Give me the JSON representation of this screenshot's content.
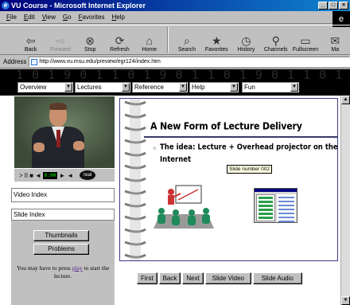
{
  "window": {
    "title": "VU Course - Microsoft Internet Explorer",
    "min_btn": "_",
    "max_btn": "□",
    "close_btn": "×"
  },
  "menu": [
    "File",
    "Edit",
    "View",
    "Go",
    "Favorites",
    "Help"
  ],
  "toolbar": [
    {
      "label": "Back",
      "icon": "back-arrow-icon",
      "glyph": "⇦",
      "enabled": true
    },
    {
      "label": "Forward",
      "icon": "forward-arrow-icon",
      "glyph": "⇨",
      "enabled": false
    },
    {
      "label": "Stop",
      "icon": "stop-icon",
      "glyph": "⊗",
      "enabled": true
    },
    {
      "label": "Refresh",
      "icon": "refresh-icon",
      "glyph": "⟳",
      "enabled": true
    },
    {
      "label": "Home",
      "icon": "home-icon",
      "glyph": "⌂",
      "enabled": true
    },
    {
      "label": "Search",
      "icon": "search-icon",
      "glyph": "⌕",
      "enabled": true
    },
    {
      "label": "Favorites",
      "icon": "favorites-icon",
      "glyph": "★",
      "enabled": true
    },
    {
      "label": "History",
      "icon": "history-icon",
      "glyph": "◷",
      "enabled": true
    },
    {
      "label": "Channels",
      "icon": "channels-icon",
      "glyph": "⚲",
      "enabled": true
    },
    {
      "label": "Fullscreen",
      "icon": "fullscreen-icon",
      "glyph": "▭",
      "enabled": true
    },
    {
      "label": "Ma",
      "icon": "mail-icon",
      "glyph": "✉",
      "enabled": true
    }
  ],
  "address": {
    "label": "Address",
    "url": "http://www.vu.msu.edu/preview/egr124/index.htm"
  },
  "nav": {
    "binary": "1 0 1 9 0 1 1 0 1 9 0 1 1 0 1 9 0 1 1 0 1 1 0 1 0 1 1",
    "selects": [
      "Overview",
      "Lectures",
      "Reference",
      "Help",
      "Fun"
    ]
  },
  "video": {
    "timecode": "0:00",
    "controls": [
      ">",
      "II",
      "■",
      "◄",
      "►",
      "◄"
    ]
  },
  "left": {
    "video_index": "Video Index",
    "slide_index": "Slide Index",
    "thumbnails_btn": "Thumbnails",
    "problems_btn": "Problems",
    "hint_before": "You may have to press ",
    "hint_link": "play",
    "hint_after": " to start the lecture."
  },
  "slide": {
    "title": "A New Form of Lecture Delivery",
    "bullet": "The idea: Lecture + Overhead projector on the Internet",
    "tooltip": "Slide number 002"
  },
  "bottom_nav": [
    "First",
    "Back",
    "Next",
    "Slide Video",
    "Slide Audio"
  ],
  "colors": {
    "titlebar": "#00007b",
    "chrome": "#c0c0c0",
    "link": "#551a8b"
  }
}
